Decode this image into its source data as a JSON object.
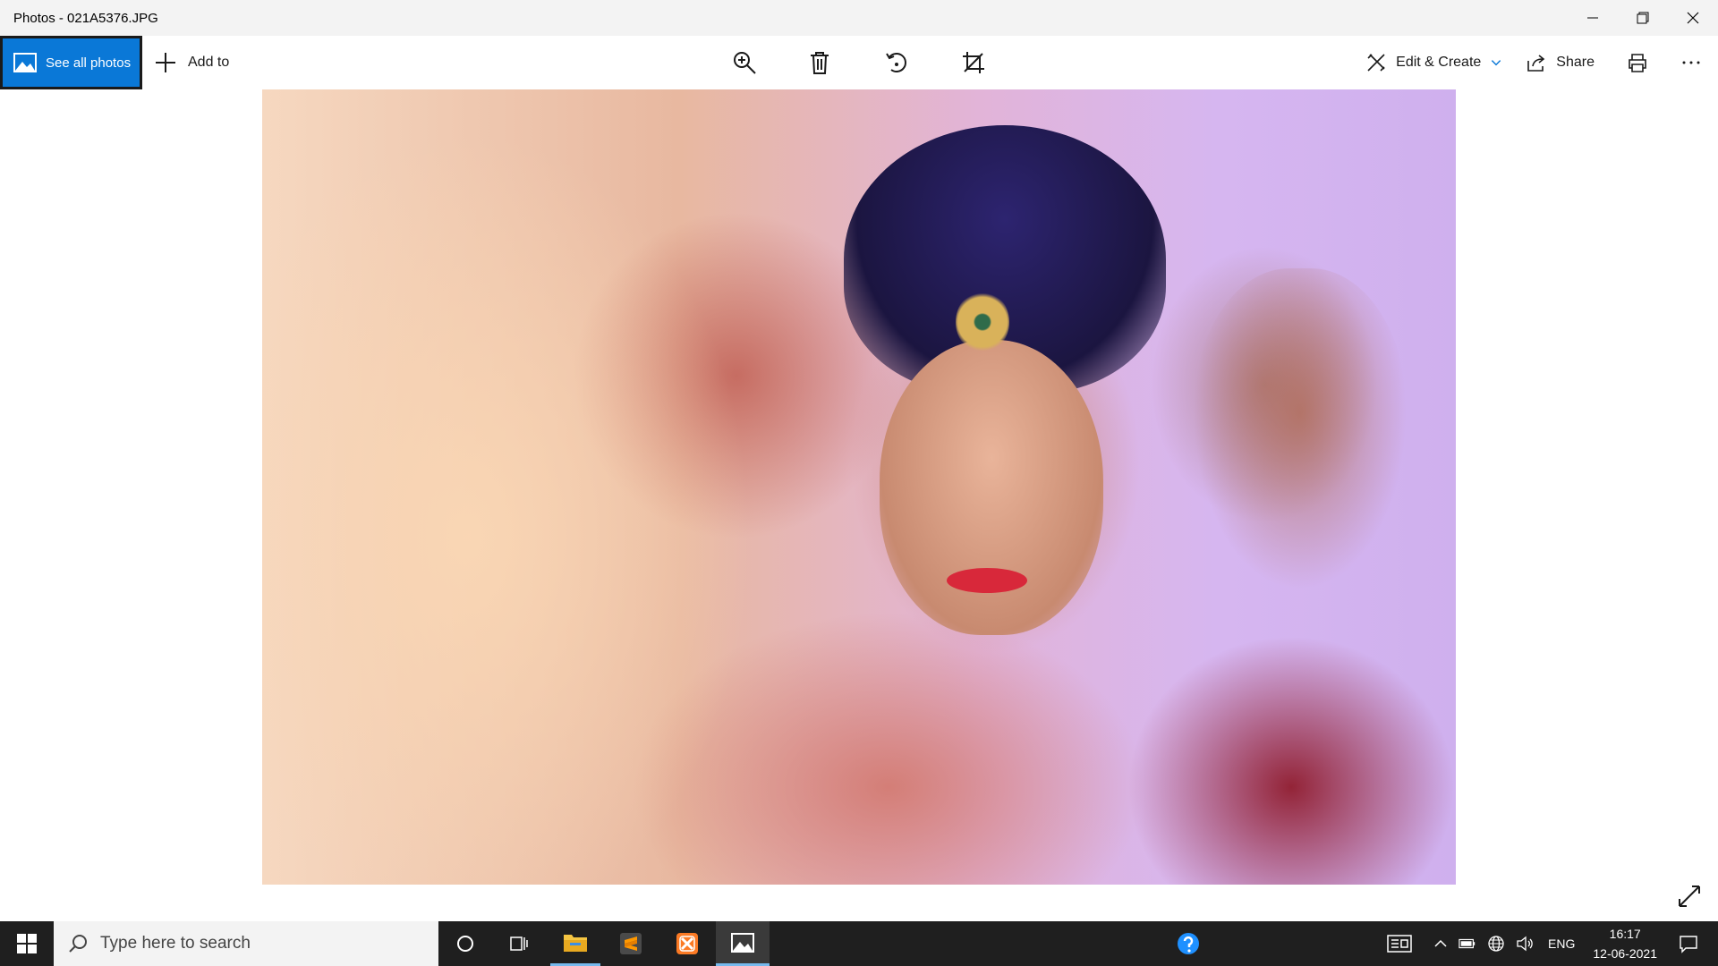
{
  "window": {
    "title": "Photos - 021A5376.JPG"
  },
  "toolbar": {
    "see_all_photos": "See all photos",
    "add_to": "Add to",
    "edit_create": "Edit & Create",
    "share": "Share"
  },
  "taskbar": {
    "search_placeholder": "Type here to search",
    "language": "ENG",
    "time": "16:17",
    "date": "12-06-2021"
  },
  "colors": {
    "accent": "#0a78d7",
    "taskbar": "#1f1f1f"
  }
}
